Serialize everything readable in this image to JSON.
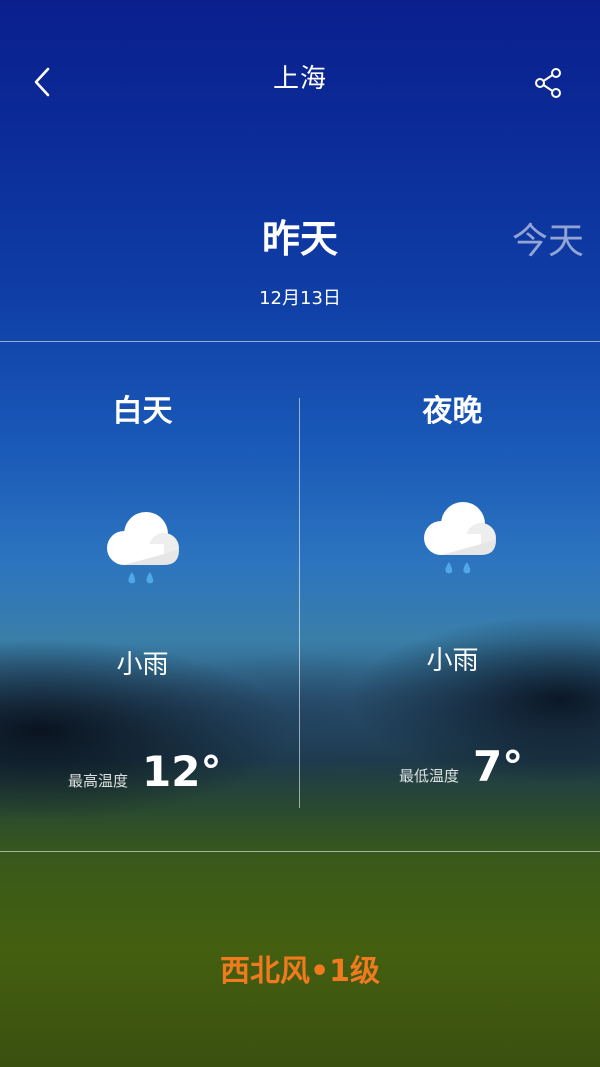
{
  "header": {
    "city": "上海",
    "back_icon": "chevron-left-icon",
    "share_icon": "share-icon"
  },
  "day_selector": {
    "current": "昨天",
    "next": "今天",
    "date": "12月13日"
  },
  "day": {
    "title": "白天",
    "icon": "cloud-rain-icon",
    "condition": "小雨",
    "temp_label": "最高温度",
    "temp": "12°"
  },
  "night": {
    "title": "夜晚",
    "icon": "cloud-rain-icon",
    "condition": "小雨",
    "temp_label": "最低温度",
    "temp": "7°"
  },
  "wind": "西北风•1级",
  "colors": {
    "wind_text": "#f07a1e",
    "raindrop": "#4fa8e8",
    "cloud": "#ffffff"
  }
}
